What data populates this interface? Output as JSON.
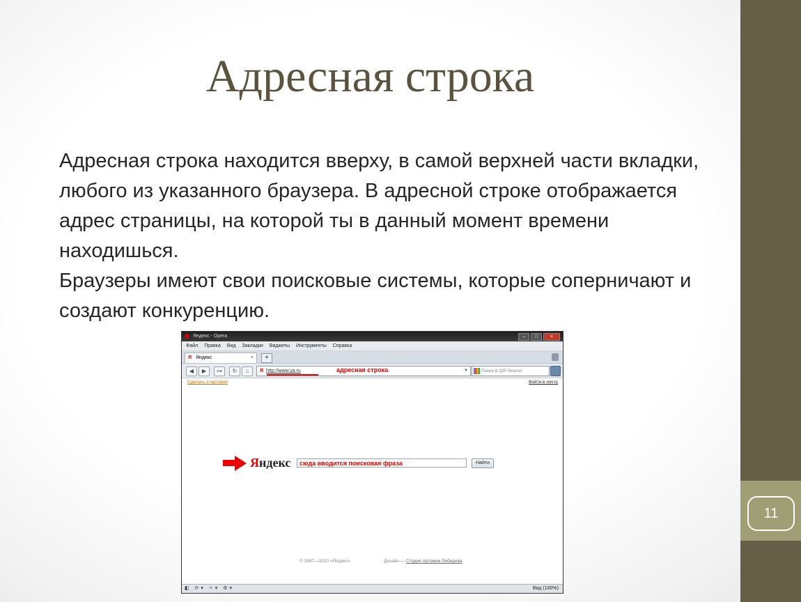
{
  "slide": {
    "title": "Адресная строка",
    "paragraph1": "Адресная строка находится вверху, в самой верхней части вкладки, любого из указанного браузера. В адресной строке отображается адрес страницы, на которой ты в данный момент времени находишься.",
    "paragraph2": "Браузеры имеют свои поисковые системы, которые соперничают и создают конкуренцию.",
    "page_number": "11"
  },
  "browser": {
    "window_title": "Яндекс - Opera",
    "menu": [
      "Файл",
      "Правка",
      "Вид",
      "Закладки",
      "Виджеты",
      "Инструменты",
      "Справка"
    ],
    "tab_icon": "Я",
    "tab_title": "Яндекс",
    "tab_close": "×",
    "new_tab": "+",
    "nav": {
      "back": "◀",
      "forward": "▶",
      "key": "⊶",
      "reload": "↻",
      "home": "⌂"
    },
    "address_icon": "Я",
    "address_url": "http://www.ya.ru",
    "address_callout": "адресная строка",
    "search_placeholder": "Поиск в QIP Search",
    "link_left": "Сделать стартовой",
    "link_right": "Войти в почту",
    "logo_first": "Я",
    "logo_rest": "ндекс",
    "search_text": "сюда вводится поисковая фраза",
    "find_button": "Найти",
    "footer_copyright": "© 1997—2010 «Яндекс»",
    "footer_design_label": "Дизайн —",
    "footer_design_link": "Студия Артемия Лебедева",
    "status_icons": "◧ ⟳▾ ✧▾ ⚙▾",
    "zoom": "Вид (100%)"
  },
  "colors": {
    "sidebar": "#675e47",
    "sidebar_lower": "#a09e74",
    "title": "#5b533d",
    "highlight_red": "#e00000"
  }
}
